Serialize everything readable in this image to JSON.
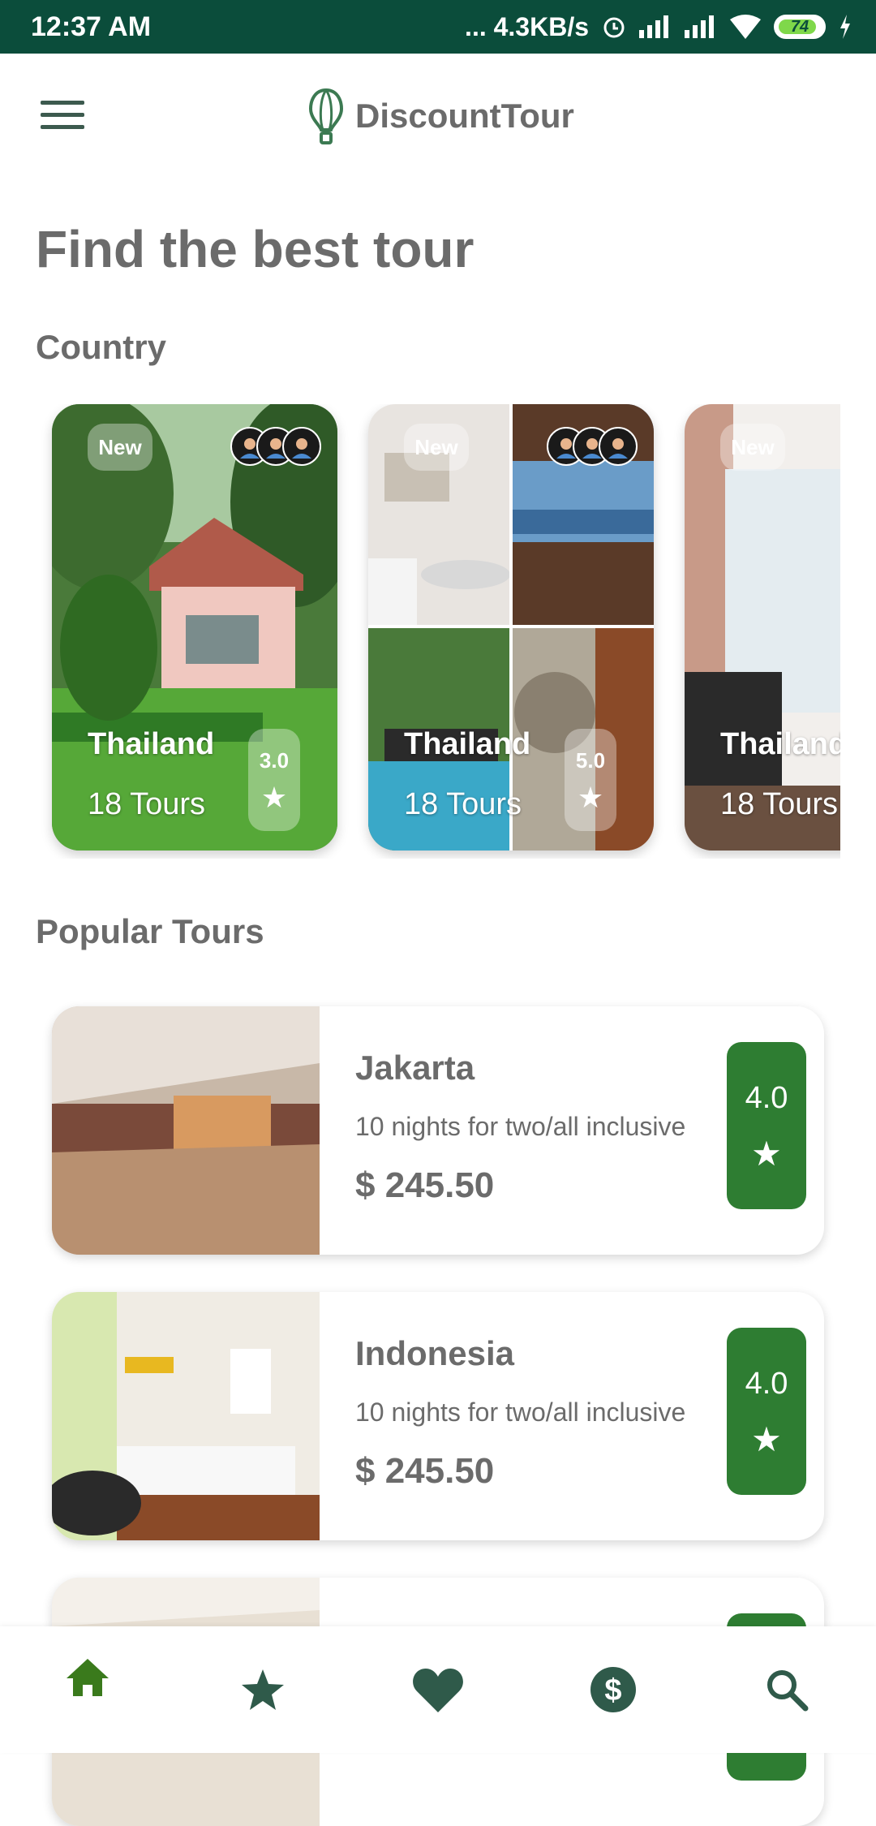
{
  "status_bar": {
    "time": "12:37 AM",
    "network_speed": "... 4.3KB/s",
    "battery": "74"
  },
  "header": {
    "brand": "DiscountTour"
  },
  "page_title": "Find the best tour",
  "sections": {
    "country": "Country",
    "popular": "Popular Tours"
  },
  "countries": [
    {
      "badge": "New",
      "name": "Thailand",
      "tours": "18 Tours",
      "rating": "3.0"
    },
    {
      "badge": "New",
      "name": "Thailand",
      "tours": "18 Tours",
      "rating": "5.0"
    },
    {
      "badge": "New",
      "name": "Thailand",
      "tours": "18 Tours",
      "rating": ""
    }
  ],
  "popular_tours": [
    {
      "name": "Jakarta",
      "desc": "10 nights for two/all inclusive",
      "price": "$ 245.50",
      "rating": "4.0"
    },
    {
      "name": "Indonesia",
      "desc": "10 nights for two/all inclusive",
      "price": "$ 245.50",
      "rating": "4.0"
    },
    {
      "name": "",
      "desc": "",
      "price": "",
      "rating": ""
    }
  ],
  "nav": [
    "home-icon",
    "star-icon",
    "heart-icon",
    "dollar-icon",
    "search-icon"
  ],
  "colors": {
    "status_bar": "#0b4d3b",
    "accent_green": "#2e7d32",
    "text_gray": "#6b6b6b"
  }
}
